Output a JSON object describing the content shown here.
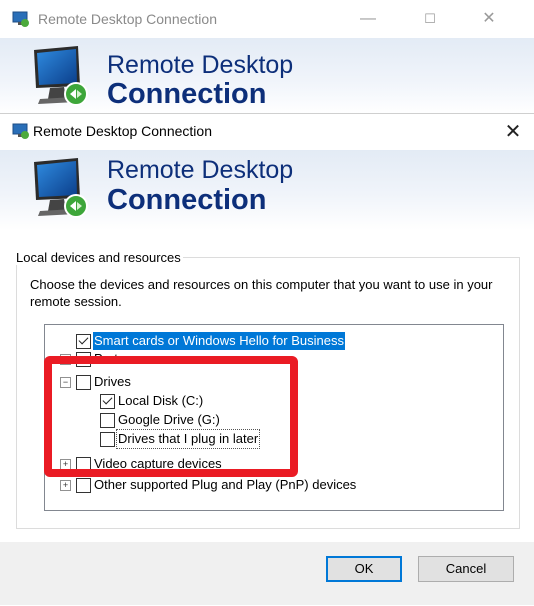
{
  "background_window": {
    "title": "Remote Desktop Connection",
    "banner_line1": "Remote Desktop",
    "banner_line2": "Connection",
    "controls": {
      "minimize": "—",
      "maximize": "☐",
      "close": "✕"
    }
  },
  "dialog": {
    "title": "Remote Desktop Connection",
    "close_glyph": "✕",
    "banner_line1": "Remote Desktop",
    "banner_line2": "Connection",
    "group_label": "Local devices and resources",
    "description": "Choose the devices and resources on this computer that you want to use in your remote session.",
    "tree": [
      {
        "label": "Smart cards or Windows Hello for Business",
        "checked": true,
        "selected": true
      },
      {
        "label": "Ports",
        "checked": false
      },
      {
        "label": "Drives",
        "checked": false,
        "expanded": true
      },
      {
        "label": "Local Disk (C:)",
        "checked": true
      },
      {
        "label": "Google Drive (G:)",
        "checked": false
      },
      {
        "label": "Drives that I plug in later",
        "checked": false,
        "focused": true
      },
      {
        "label": "Video capture devices",
        "checked": false,
        "expanded": false
      },
      {
        "label": "Other supported Plug and Play (PnP) devices",
        "checked": false,
        "expanded": false
      }
    ],
    "buttons": {
      "ok": "OK",
      "cancel": "Cancel"
    }
  },
  "colors": {
    "banner_text": "#0d2f7a",
    "selection": "#0078d7",
    "annotation_red": "#ea1b24"
  }
}
